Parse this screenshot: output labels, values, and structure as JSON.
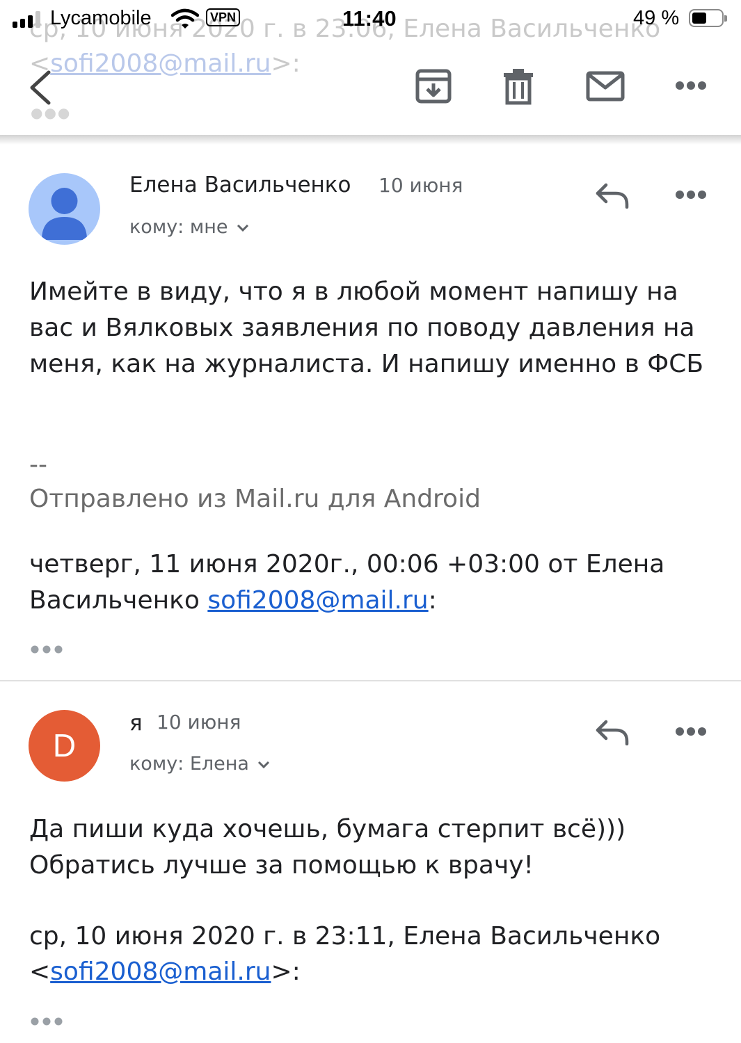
{
  "status_bar": {
    "carrier": "Lycamobile",
    "vpn": "VPN",
    "time": "11:40",
    "battery_percent": "49 %",
    "battery_level": 0.49,
    "signal_bars": 3
  },
  "background_text": {
    "line1": "ср, 10 июня 2020 г. в 23:06, Елена Васильченко",
    "line2_open": "<",
    "line2_email": "sofi2008@mail.ru",
    "line2_close": ">:"
  },
  "toolbar": {
    "icons": [
      "back-icon",
      "archive-icon",
      "trash-icon",
      "mark-unread-icon",
      "more-icon"
    ]
  },
  "messages": [
    {
      "sender": "Елена Васильченко",
      "date": "10 июня",
      "recipient": "кому: мне",
      "avatar": "person-icon",
      "body": "Имейте в виду, что я в любой момент напишу на вас и Вялковых заявления по поводу давления на меня, как на журналиста. И напишу именно в ФСБ",
      "signature_separator": "--",
      "signature": "Отправлено из Mail.ru для Android",
      "quote_header": "четверг, 11 июня 2020г., 00:06 +03:00 от Елена Васильченко ",
      "quote_email": "sofi2008@mail.ru",
      "quote_suffix": ":"
    },
    {
      "sender": "я",
      "date": "10 июня",
      "recipient": "кому: Елена",
      "avatar_letter": "D",
      "body_line1": "Да пиши куда хочешь, бумага стерпит всё)))",
      "body_line2": "Обратись лучше за помощью к врачу!",
      "quote_header": "ср, 10 июня 2020 г. в 23:11, Елена Васильченко",
      "quote_open": "<",
      "quote_email": "sofi2008@mail.ru",
      "quote_close": ">:"
    }
  ],
  "colors": {
    "accent_link": "#1a5fd0",
    "avatar_person_bg": "#a8c7fa",
    "avatar_person_fg": "#3f6fd6",
    "avatar_letter_bg": "#e45c35",
    "icon_gray": "#5f6368"
  }
}
